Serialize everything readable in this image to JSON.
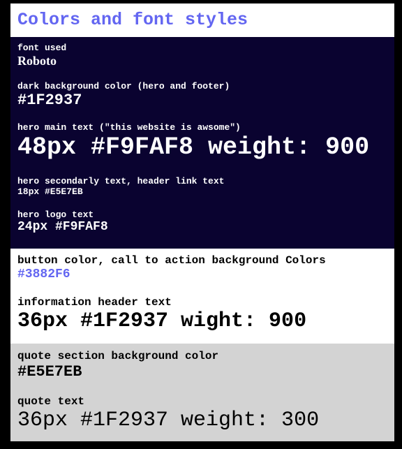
{
  "page": {
    "title": "Colors and font styles"
  },
  "dark_section": {
    "font_label": "font used",
    "font_value": "Roboto",
    "bg_label": "dark background color (hero and footer)",
    "bg_value": "#1F2937",
    "hero_main_label": "hero main text (\"this website is awsome\")",
    "hero_main_value": "48px #F9FAF8 weight: 900",
    "hero_secondary_label": "hero secondarly text, header link text",
    "hero_secondary_value": "18px #E5E7EB",
    "hero_logo_label": "hero logo text",
    "hero_logo_value": "24px #F9FAF8"
  },
  "white_section": {
    "button_label": "button color, call to action background Colors",
    "button_value": "#3882F6",
    "info_label": "information header text",
    "info_value": "36px #1F2937 wight: 900"
  },
  "grey_section": {
    "quote_bg_label": "quote section background color",
    "quote_bg_value": "#E5E7EB",
    "quote_text_label": "quote text",
    "quote_text_value": "36px #1F2937 weight: 300"
  },
  "colors": {
    "outer_background": "#000000",
    "title_accent": "#6366F1",
    "dark_panel": "#0A0330",
    "light_panel": "#FFFFFF",
    "grey_panel": "#D3D3D3"
  }
}
